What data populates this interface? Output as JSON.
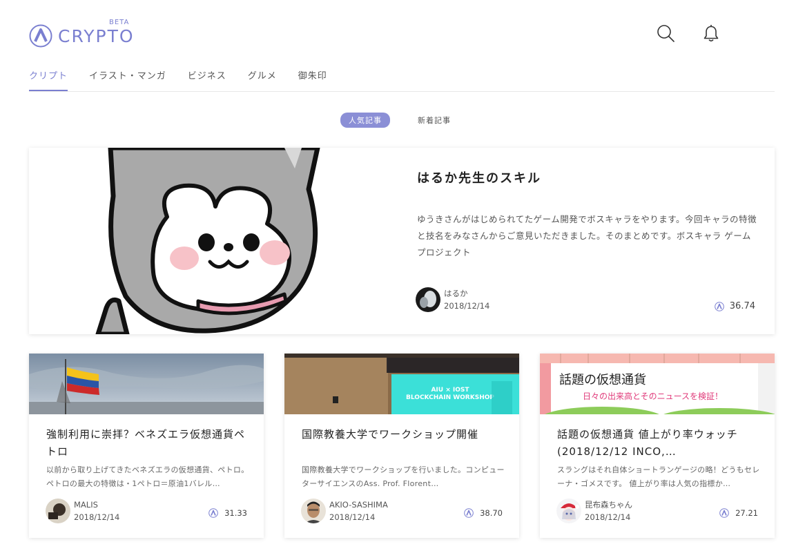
{
  "brand": {
    "name": "CRYPTO",
    "badge": "BETA",
    "accent_color": "#7a7fd0"
  },
  "header": {
    "icons": [
      "search-icon",
      "bell-icon"
    ]
  },
  "categories": [
    {
      "label": "クリプト",
      "active": true
    },
    {
      "label": "イラスト・マンガ",
      "active": false
    },
    {
      "label": "ビジネス",
      "active": false
    },
    {
      "label": "グルメ",
      "active": false
    },
    {
      "label": "御朱印",
      "active": false
    }
  ],
  "sort_tabs": {
    "popular": "人気記事",
    "newest": "新着記事"
  },
  "featured": {
    "title": "はるか先生のスキル",
    "description": "ゆうきさんがはじめられてたゲーム開発でボスキャラをやります。今回キャラの特徴と技名をみなさんからご意見いただきました。そのまとめです。ボスキャラ ゲームプロジェクト",
    "author": "はるか",
    "date": "2018/12/14",
    "score": "36.74"
  },
  "cards": [
    {
      "title": "強制利用に崇拝？ベネズエラ仮想通貨ペトロ",
      "description": "以前から取り上げてきたベネズエラの仮想通貨、ペトロ。ペトロの最大の特徴は・1ペトロ＝原油1バレル…",
      "author": "MALIS",
      "date": "2018/12/14",
      "score": "31.33"
    },
    {
      "title": "国際教養大学でワークショップ開催",
      "description": "国際教養大学でワークショップを行いました。コンピューターサイエンスのAss. Prof. Florent…",
      "author": "AKIO-SASHIMA",
      "date": "2018/12/14",
      "score": "38.70",
      "image_text": [
        "AIU × IOST",
        "BLOCKCHAIN WORKSHOP"
      ]
    },
    {
      "title": "話題の仮想通貨 値上がり率ウォッチ(2018/12/12 INCO,…",
      "description": "スラングはそれ自体ショートランゲージの略！どうもセレーナ・ゴメスです。 値上がり率は人気の指標か…",
      "author": "昆布森ちゃん",
      "date": "2018/12/14",
      "score": "27.21",
      "image_text": [
        "話題の仮想通貨",
        "日々の出来高とそのニュースを検証！"
      ]
    }
  ]
}
